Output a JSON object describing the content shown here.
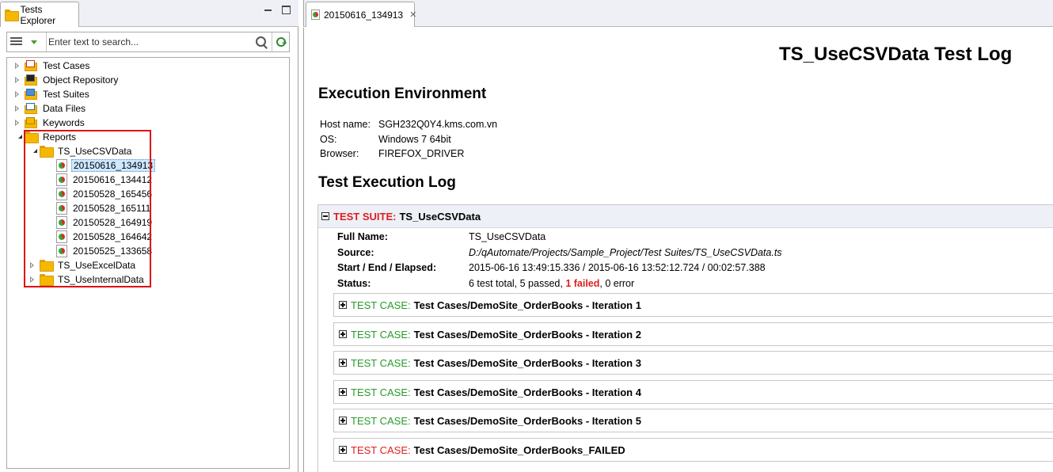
{
  "left_panel": {
    "tab_title": "Tests Explorer",
    "search": {
      "placeholder": "Enter text to search...",
      "value": ""
    },
    "tree": [
      {
        "label": "Test Cases",
        "icon": "test-cases-icon"
      },
      {
        "label": "Object Repository",
        "icon": "object-repository-icon"
      },
      {
        "label": "Test Suites",
        "icon": "test-suites-icon"
      },
      {
        "label": "Data Files",
        "icon": "data-files-icon"
      },
      {
        "label": "Keywords",
        "icon": "keywords-icon"
      },
      {
        "label": "Reports",
        "icon": "folder-icon"
      },
      {
        "label": "TS_UseCSVData",
        "icon": "folder-icon"
      },
      {
        "label": "20150616_134913",
        "icon": "report-icon",
        "selected": true
      },
      {
        "label": "20150616_134412",
        "icon": "report-icon"
      },
      {
        "label": "20150528_165456",
        "icon": "report-icon"
      },
      {
        "label": "20150528_165111",
        "icon": "report-icon"
      },
      {
        "label": "20150528_164919",
        "icon": "report-icon"
      },
      {
        "label": "20150528_164642",
        "icon": "report-icon"
      },
      {
        "label": "20150525_133658",
        "icon": "report-icon"
      },
      {
        "label": "TS_UseExcelData",
        "icon": "folder-icon"
      },
      {
        "label": "TS_UseInternalData",
        "icon": "folder-icon"
      }
    ]
  },
  "editor": {
    "tab_label": "20150616_134913",
    "tab_close": "✕",
    "title": "TS_UseCSVData Test Log",
    "env_heading": "Execution Environment",
    "env": [
      {
        "label": "Host name:",
        "value": "SGH232Q0Y4.kms.com.vn"
      },
      {
        "label": "OS:",
        "value": "Windows 7 64bit"
      },
      {
        "label": "Browser:",
        "value": "FIREFOX_DRIVER"
      }
    ],
    "log_heading": "Test Execution Log",
    "suite": {
      "keyword": "TEST SUITE:",
      "name": "TS_UseCSVData",
      "full_name_label": "Full Name:",
      "full_name": "TS_UseCSVData",
      "source_label": "Source:",
      "source": "D:/qAutomate/Projects/Sample_Project/Test Suites/TS_UseCSVData.ts",
      "timing_label": "Start / End / Elapsed:",
      "timing": "2015-06-16 13:49:15.336 / 2015-06-16 13:52:12.724 / 00:02:57.388",
      "status_label": "Status:",
      "status_total": "6 test total, 5 passed,",
      "status_failed": "1 failed",
      "status_error": ", 0 error"
    },
    "cases": [
      {
        "keyword": "TEST CASE:",
        "name": "Test Cases/DemoSite_OrderBooks - Iteration 1",
        "status": "passed"
      },
      {
        "keyword": "TEST CASE:",
        "name": "Test Cases/DemoSite_OrderBooks - Iteration 2",
        "status": "passed"
      },
      {
        "keyword": "TEST CASE:",
        "name": "Test Cases/DemoSite_OrderBooks - Iteration 3",
        "status": "passed"
      },
      {
        "keyword": "TEST CASE:",
        "name": "Test Cases/DemoSite_OrderBooks - Iteration 4",
        "status": "passed"
      },
      {
        "keyword": "TEST CASE:",
        "name": "Test Cases/DemoSite_OrderBooks - Iteration 5",
        "status": "passed"
      },
      {
        "keyword": "TEST CASE:",
        "name": "Test Cases/DemoSite_OrderBooks_FAILED",
        "status": "failed"
      }
    ],
    "colors": {
      "failed": "#e01e1e",
      "passed": "#2a9a2a",
      "highlight_border": "#e01010"
    }
  }
}
